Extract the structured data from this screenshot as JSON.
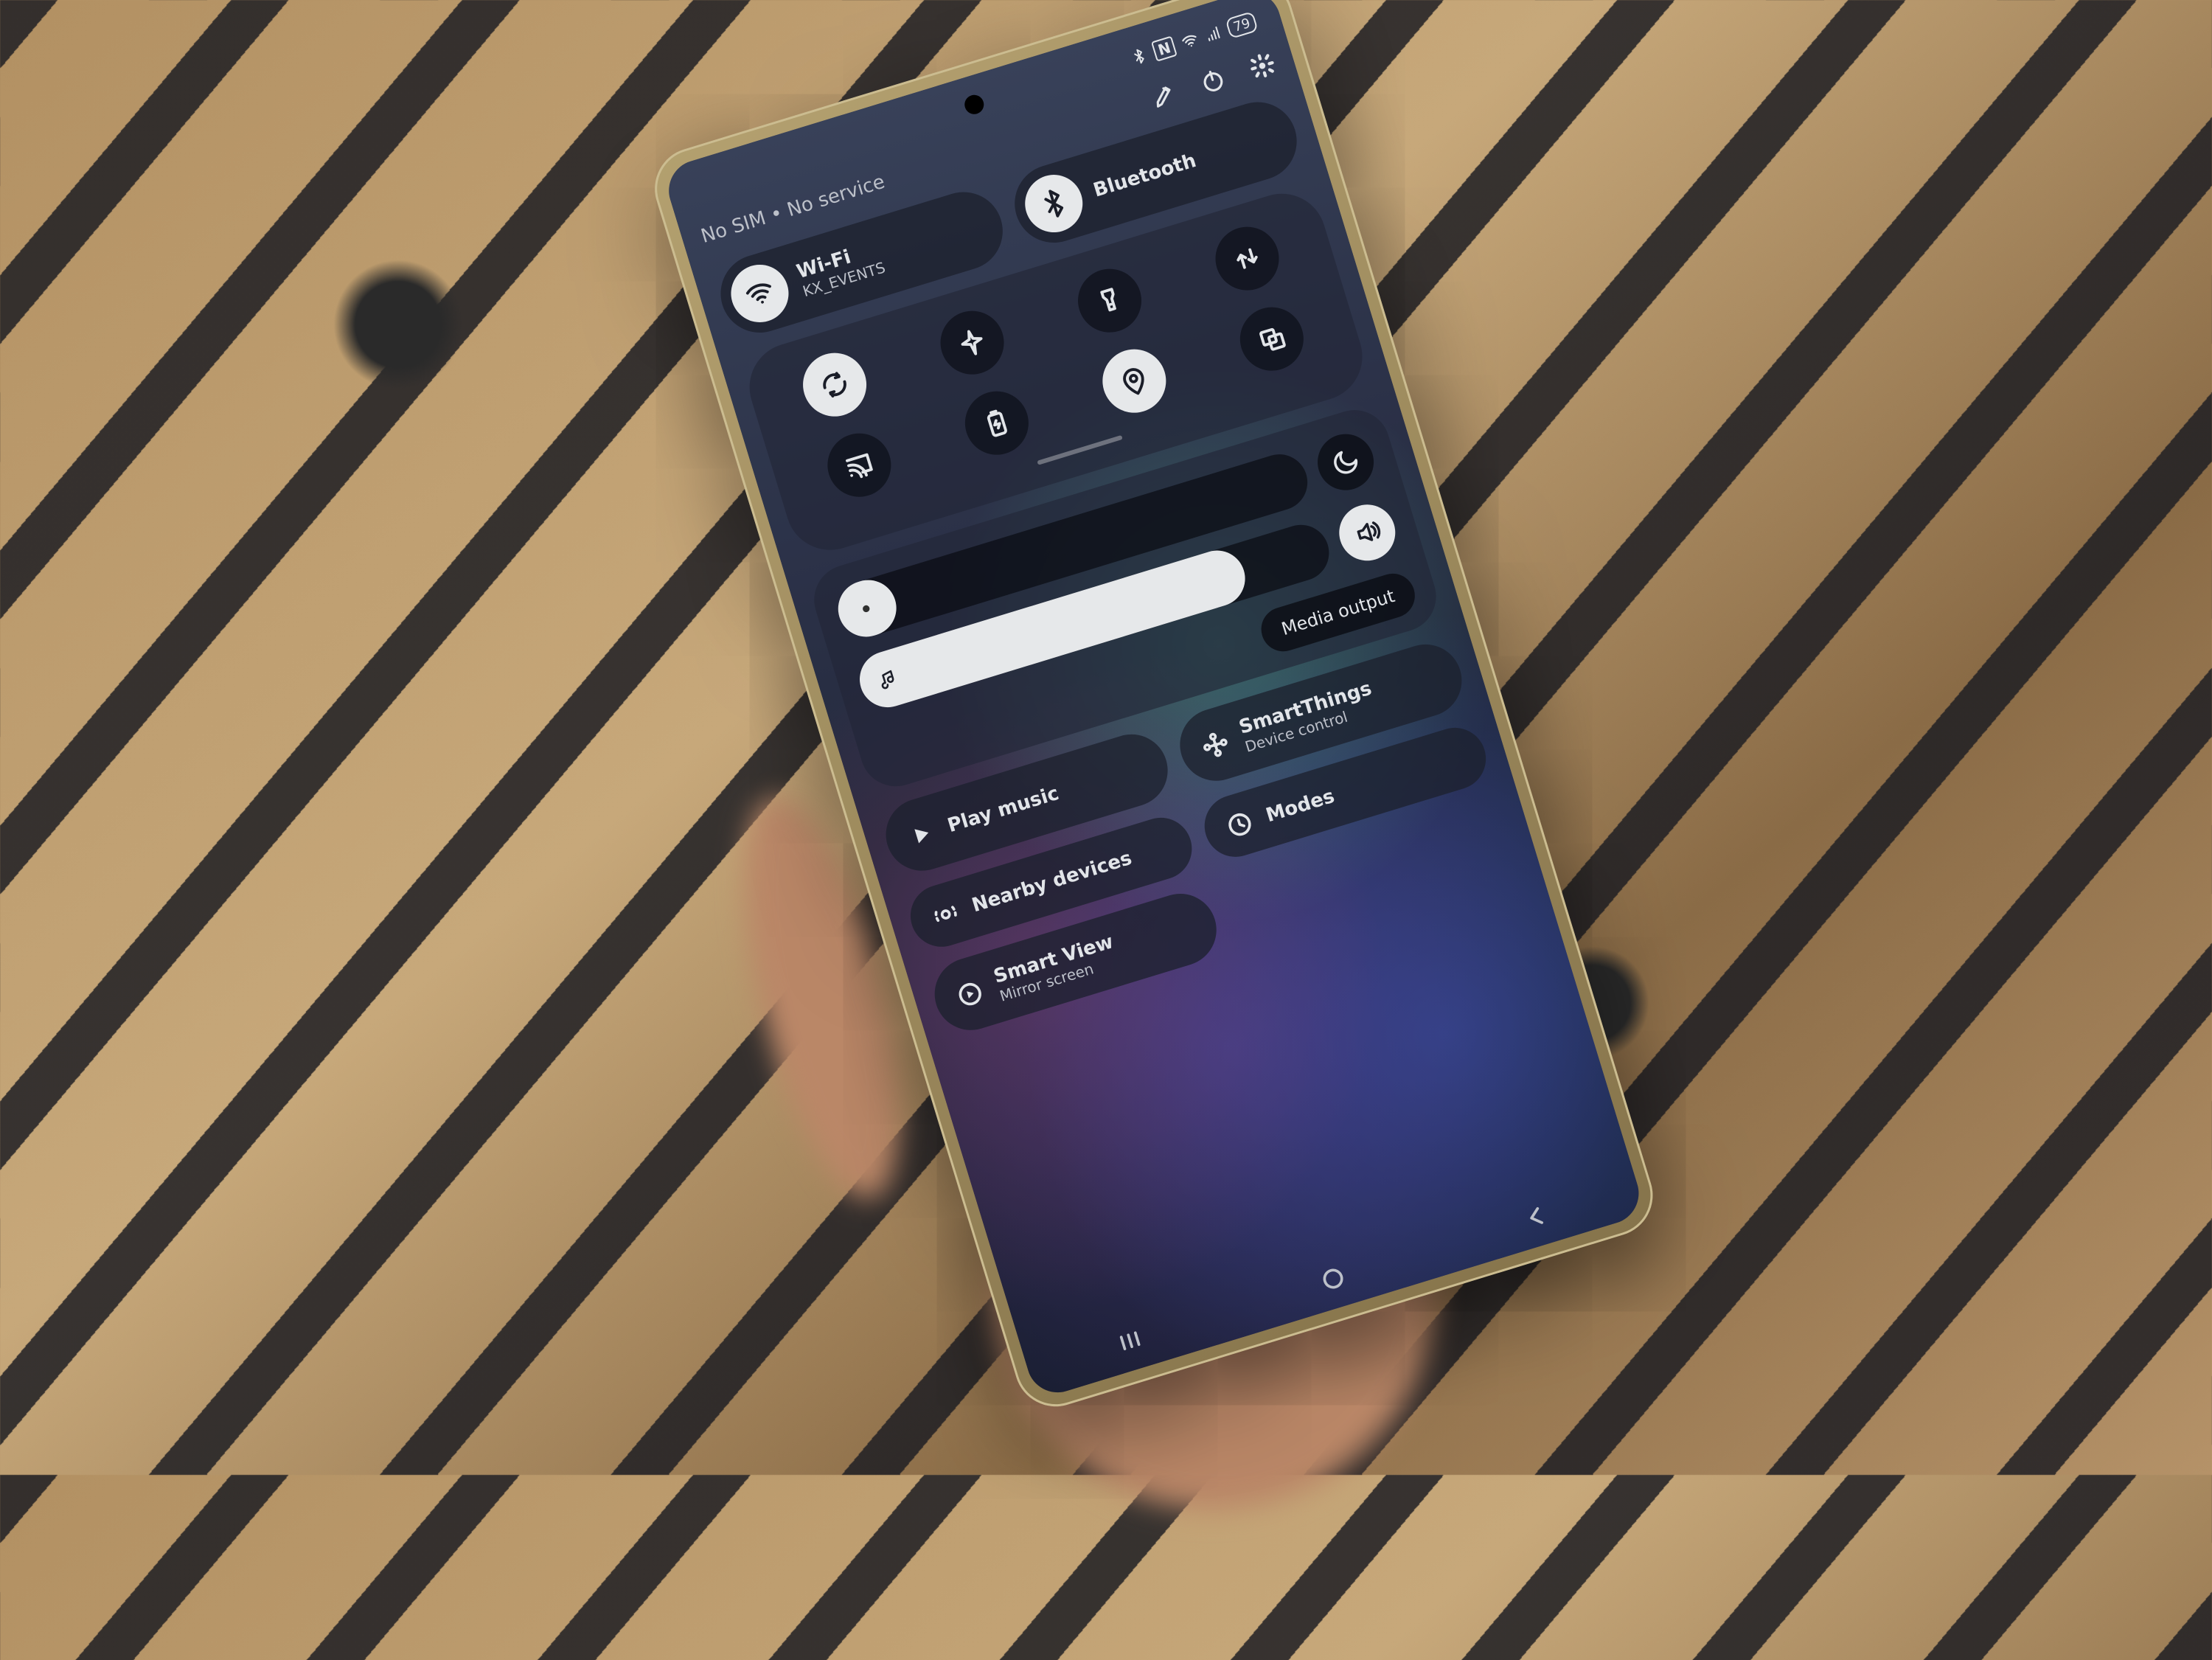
{
  "status_bar": {
    "battery": "79",
    "icons": [
      "bluetooth",
      "nfc",
      "wifi",
      "signal",
      "battery"
    ]
  },
  "header": {
    "sim_status": "No SIM • No service"
  },
  "quick_connect": {
    "wifi": {
      "title": "Wi-Fi",
      "subtitle": "KX_EVENTS",
      "active": true
    },
    "bluetooth": {
      "title": "Bluetooth",
      "active": true
    }
  },
  "toggles": [
    {
      "name": "auto-rotate",
      "active": true
    },
    {
      "name": "airplane-mode",
      "active": false
    },
    {
      "name": "flashlight",
      "active": false
    },
    {
      "name": "mobile-data",
      "active": false
    },
    {
      "name": "cast",
      "active": false
    },
    {
      "name": "power-saving",
      "active": false
    },
    {
      "name": "location",
      "active": true
    },
    {
      "name": "multi-window",
      "active": false
    }
  ],
  "sliders": {
    "brightness": {
      "percent": 12
    },
    "volume": {
      "percent": 82
    },
    "do_not_disturb_active": false,
    "sound_mode": "sound",
    "media_output_label": "Media output"
  },
  "shortcuts": {
    "play_music": {
      "label": "Play music"
    },
    "smartthings": {
      "label": "SmartThings",
      "sublabel": "Device control"
    },
    "nearby": {
      "label": "Nearby devices"
    },
    "modes": {
      "label": "Modes"
    },
    "smartview": {
      "label": "Smart View",
      "sublabel": "Mirror screen"
    }
  }
}
